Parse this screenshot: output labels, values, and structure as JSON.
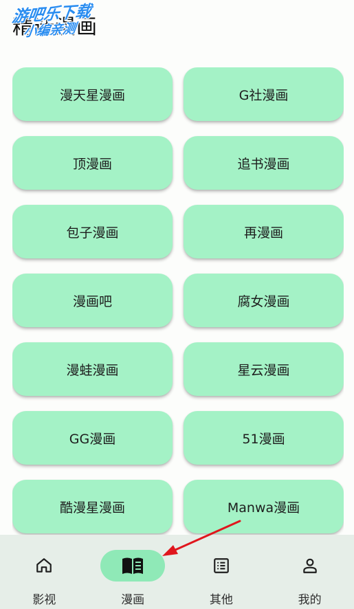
{
  "header": {
    "title": "精选漫画",
    "watermark_line1": "游吧乐下载",
    "watermark_line2": "小编亲测"
  },
  "sources": [
    {
      "label": "漫天星漫画"
    },
    {
      "label": "G社漫画"
    },
    {
      "label": "顶漫画"
    },
    {
      "label": "追书漫画"
    },
    {
      "label": "包子漫画"
    },
    {
      "label": "再漫画"
    },
    {
      "label": "漫画吧"
    },
    {
      "label": "腐女漫画"
    },
    {
      "label": "漫蛙漫画"
    },
    {
      "label": "星云漫画"
    },
    {
      "label": "GG漫画"
    },
    {
      "label": "51漫画"
    },
    {
      "label": "酷漫星漫画"
    },
    {
      "label": "Manwa漫画"
    }
  ],
  "bottom_nav": {
    "items": [
      {
        "label": "影视",
        "icon": "home-icon",
        "active": false
      },
      {
        "label": "漫画",
        "icon": "book-icon",
        "active": true
      },
      {
        "label": "其他",
        "icon": "list-icon",
        "active": false
      },
      {
        "label": "我的",
        "icon": "person-icon",
        "active": false
      }
    ]
  },
  "colors": {
    "card_bg": "#a4f2c6",
    "active_pill": "#8fe9b7",
    "nav_bg": "#e6eee8",
    "annotation_arrow": "#e0161d",
    "watermark": "#2a8df0"
  }
}
